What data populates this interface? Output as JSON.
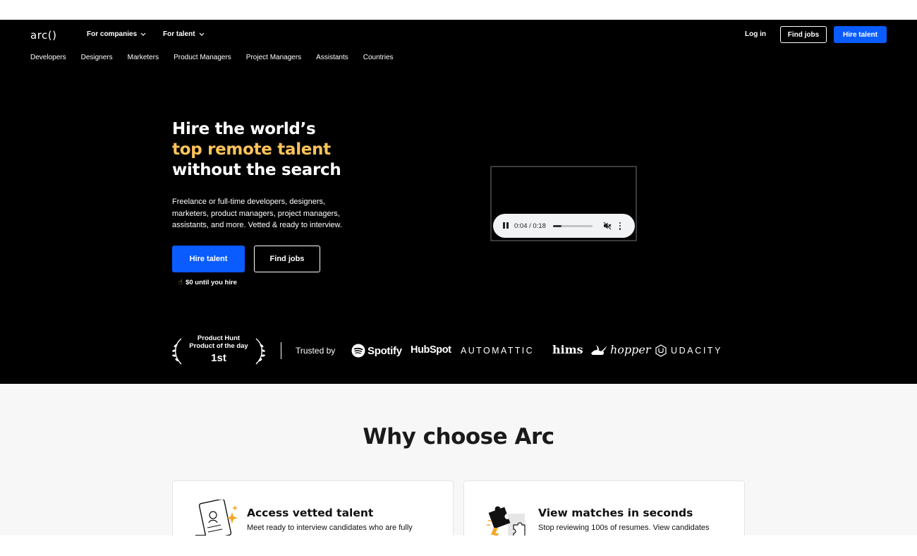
{
  "header": {
    "logo": "arc()",
    "nav": [
      {
        "label": "For companies"
      },
      {
        "label": "For talent"
      }
    ],
    "login_label": "Log in",
    "find_jobs_label": "Find jobs",
    "hire_talent_label": "Hire talent"
  },
  "subnav": {
    "items": [
      "Developers",
      "Designers",
      "Marketers",
      "Product Managers",
      "Project Managers",
      "Assistants",
      "Countries"
    ]
  },
  "hero": {
    "headline_line1": "Hire the world’s",
    "headline_line2": "top remote talent",
    "headline_line3": "without the search",
    "description": "Freelance or full-time developers, designers, marketers, product managers, project managers, assistants, and more. Vetted & ready to interview.",
    "hire_button": "Hire talent",
    "jobs_button": "Find jobs",
    "note": "$0 until you hire"
  },
  "video": {
    "time": "0:04 / 0:18",
    "progress": 0.22
  },
  "social_proof": {
    "badge_line1": "Product Hunt",
    "badge_line2": "Product of the day",
    "badge_rank": "1st",
    "trusted_label": "Trusted by",
    "brands": [
      "Spotify",
      "HubSpot",
      "AUTOMATTIC",
      "hims",
      "hopper",
      "UDACITY"
    ]
  },
  "why": {
    "title": "Why choose Arc",
    "cards": [
      {
        "title": "Access vetted talent",
        "desc": "Meet ready to interview candidates who are fully"
      },
      {
        "title": "View matches in seconds",
        "desc": "Stop reviewing 100s of resumes. View candidates"
      }
    ]
  },
  "colors": {
    "accent_yellow": "#ffc45a",
    "brand_blue": "#0a5cff",
    "hero_bg": "#000000",
    "section_bg": "#f7f7f7"
  }
}
